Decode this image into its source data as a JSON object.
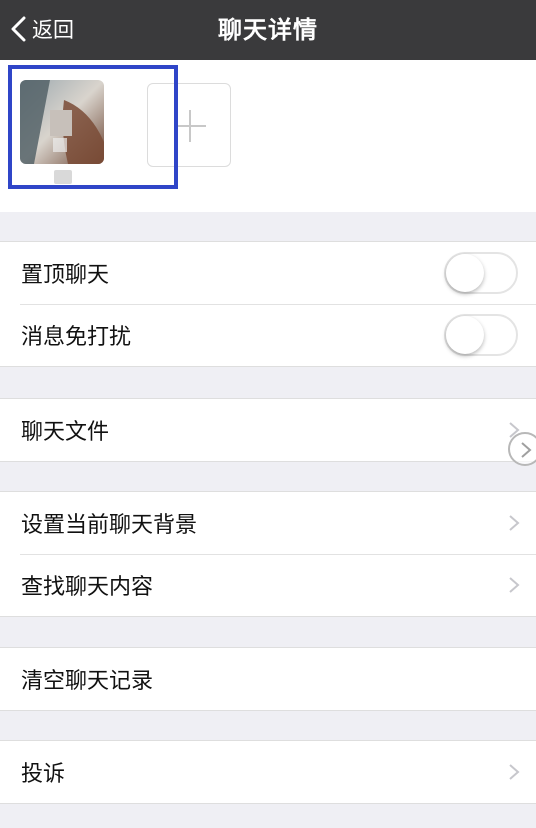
{
  "navbar": {
    "back_label": "返回",
    "title": "聊天详情"
  },
  "members": {
    "add_button": "+",
    "avatar_caption": "..."
  },
  "groups": {
    "top": [
      {
        "label": "置顶聊天",
        "toggle": "off"
      },
      {
        "label": "消息免打扰",
        "toggle": "off"
      }
    ],
    "files": [
      {
        "label": "聊天文件"
      }
    ],
    "background": [
      {
        "label": "设置当前聊天背景"
      },
      {
        "label": "查找聊天内容"
      }
    ],
    "clear": [
      {
        "label": "清空聊天记录"
      }
    ],
    "report": [
      {
        "label": "投诉"
      }
    ]
  },
  "colors": {
    "navbar": "#3a3a3c",
    "page_background": "#efeff4",
    "highlight_box": "#2f45c8"
  },
  "icons": [
    "back-chevron-icon",
    "avatar-image",
    "plus-icon",
    "chevron-right-icon",
    "floating-forward-icon"
  ]
}
